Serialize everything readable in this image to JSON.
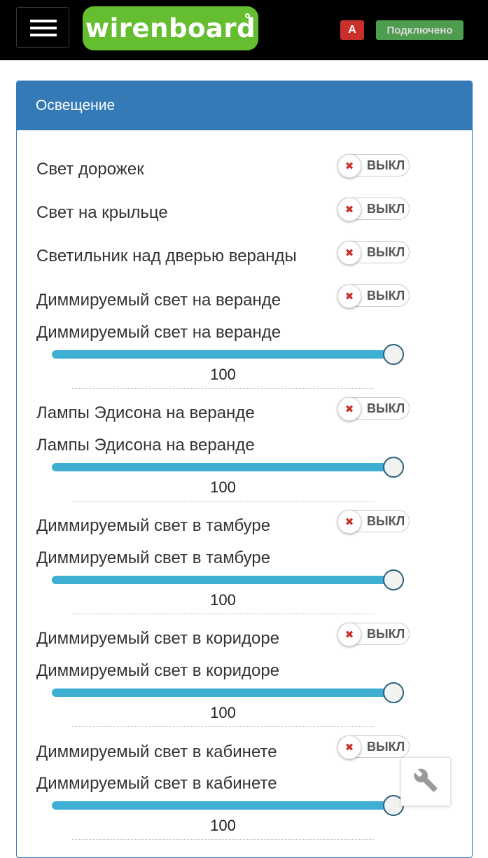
{
  "header": {
    "logo_text": "wirenboard",
    "badge_a": "A",
    "status": "Подключено"
  },
  "panel": {
    "title": "Освещение"
  },
  "switches": [
    {
      "label": "Свет дорожек",
      "state": "ВЫКЛ"
    },
    {
      "label": "Свет на крыльце",
      "state": "ВЫКЛ"
    },
    {
      "label": "Светильник над дверью веранды",
      "state": "ВЫКЛ"
    },
    {
      "label": "Диммируемый свет на веранде",
      "state": "ВЫКЛ"
    },
    {
      "label": "Лампы Эдисона на веранде",
      "state": "ВЫКЛ"
    },
    {
      "label": "Диммируемый свет в тамбуре",
      "state": "ВЫКЛ"
    },
    {
      "label": "Диммируемый свет в коридоре",
      "state": "ВЫКЛ"
    },
    {
      "label": "Диммируемый свет в кабинете",
      "state": "ВЫКЛ"
    }
  ],
  "sliders": [
    {
      "label": "Диммируемый свет на веранде",
      "value": "100",
      "level": 1.0
    },
    {
      "label": "Лампы Эдисона на веранде",
      "value": "100",
      "level": 1.0
    },
    {
      "label": "Диммируемый свет в тамбуре",
      "value": "100",
      "level": 1.0
    },
    {
      "label": "Диммируемый свет в коридоре",
      "value": "100",
      "level": 1.0
    },
    {
      "label": "Диммируемый свет в кабинете",
      "value": "100",
      "level": 1.0
    }
  ],
  "icons": {
    "menu": "hamburger-menu-icon",
    "toggle_off": "close-icon",
    "settings": "wrench-icon"
  },
  "colors": {
    "panel_header": "#337ab7",
    "logo_green": "#64be2f",
    "alert_red": "#c9302c",
    "connected_green": "#5cb85c",
    "slider_track": "#3eaed2"
  }
}
